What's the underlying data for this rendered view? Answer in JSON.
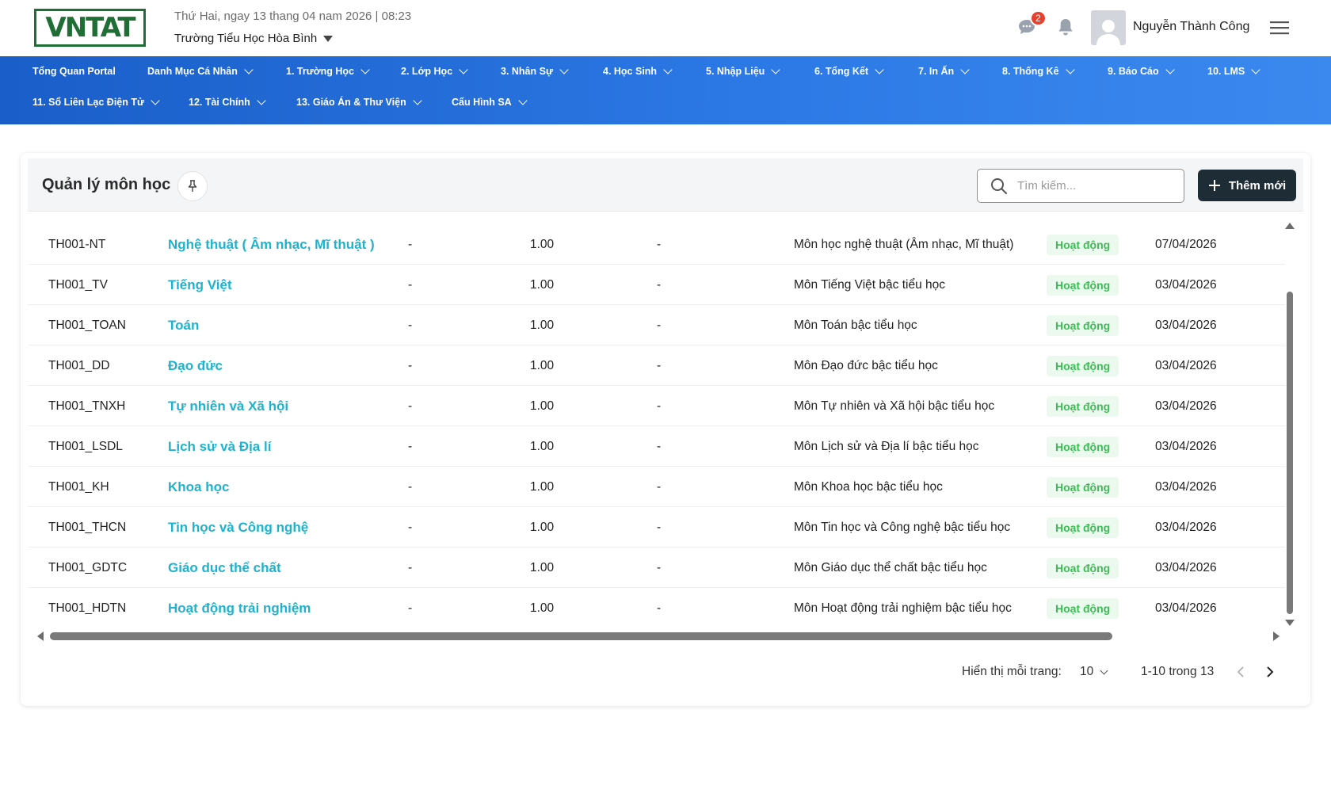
{
  "header": {
    "logo_text": "VNTAT",
    "date_line": "Thứ Hai, ngay 13 thang 04 nam 2026 | 08:23",
    "school_name": "Trường Tiểu Học Hòa Bình",
    "chat_badge_count": "2",
    "user_name": "Nguyễn Thành Công"
  },
  "nav": {
    "row1": [
      {
        "label": "Tổng Quan Portal",
        "has_dropdown": false
      },
      {
        "label": "Danh Mục Cá Nhân",
        "has_dropdown": true
      },
      {
        "label": "1. Trường Học",
        "has_dropdown": true
      },
      {
        "label": "2. Lớp Học",
        "has_dropdown": true
      },
      {
        "label": "3. Nhân Sự",
        "has_dropdown": true
      },
      {
        "label": "4. Học Sinh",
        "has_dropdown": true
      },
      {
        "label": "5. Nhập Liệu",
        "has_dropdown": true
      },
      {
        "label": "6. Tổng Kết",
        "has_dropdown": true
      },
      {
        "label": "7. In Ấn",
        "has_dropdown": true
      },
      {
        "label": "8. Thống Kê",
        "has_dropdown": true
      },
      {
        "label": "9. Báo Cáo",
        "has_dropdown": true
      },
      {
        "label": "10. LMS",
        "has_dropdown": true
      }
    ],
    "row2": [
      {
        "label": "11. Sổ Liên Lạc Điện Tử",
        "has_dropdown": true
      },
      {
        "label": "12. Tài Chính",
        "has_dropdown": true
      },
      {
        "label": "13. Giáo Án & Thư Viện",
        "has_dropdown": true
      },
      {
        "label": "Cấu Hình SA",
        "has_dropdown": true
      }
    ]
  },
  "page": {
    "title": "Quản lý môn học",
    "search_placeholder": "Tìm kiếm...",
    "add_button_label": "Thêm mới"
  },
  "table": {
    "rows": [
      {
        "code": "TH001-NT",
        "name": "Nghệ thuật ( Âm nhạc, Mĩ thuật )",
        "col3": "-",
        "coef": "1.00",
        "col5": "-",
        "description": "Môn học nghệ thuật (Âm nhạc, Mĩ thuật)",
        "status": "Hoạt động",
        "date": "07/04/2026"
      },
      {
        "code": "TH001_TV",
        "name": "Tiếng Việt",
        "col3": "-",
        "coef": "1.00",
        "col5": "-",
        "description": "Môn Tiếng Việt bậc tiểu học",
        "status": "Hoạt động",
        "date": "03/04/2026"
      },
      {
        "code": "TH001_TOAN",
        "name": "Toán",
        "col3": "-",
        "coef": "1.00",
        "col5": "-",
        "description": "Môn Toán bậc tiểu học",
        "status": "Hoạt động",
        "date": "03/04/2026"
      },
      {
        "code": "TH001_DD",
        "name": "Đạo đức",
        "col3": "-",
        "coef": "1.00",
        "col5": "-",
        "description": "Môn Đạo đức bậc tiểu học",
        "status": "Hoạt động",
        "date": "03/04/2026"
      },
      {
        "code": "TH001_TNXH",
        "name": "Tự nhiên và Xã hội",
        "col3": "-",
        "coef": "1.00",
        "col5": "-",
        "description": "Môn Tự nhiên và Xã hội bậc tiểu học",
        "status": "Hoạt động",
        "date": "03/04/2026"
      },
      {
        "code": "TH001_LSDL",
        "name": "Lịch sử và Địa lí",
        "col3": "-",
        "coef": "1.00",
        "col5": "-",
        "description": "Môn Lịch sử và Địa lí bậc tiểu học",
        "status": "Hoạt động",
        "date": "03/04/2026"
      },
      {
        "code": "TH001_KH",
        "name": "Khoa học",
        "col3": "-",
        "coef": "1.00",
        "col5": "-",
        "description": "Môn Khoa học bậc tiểu học",
        "status": "Hoạt động",
        "date": "03/04/2026"
      },
      {
        "code": "TH001_THCN",
        "name": "Tin học và Công nghệ",
        "col3": "-",
        "coef": "1.00",
        "col5": "-",
        "description": "Môn Tin học và Công nghệ bậc tiểu học",
        "status": "Hoạt động",
        "date": "03/04/2026"
      },
      {
        "code": "TH001_GDTC",
        "name": "Giáo dục thể chất",
        "col3": "-",
        "coef": "1.00",
        "col5": "-",
        "description": "Môn Giáo dục thể chất bậc tiểu học",
        "status": "Hoạt động",
        "date": "03/04/2026"
      },
      {
        "code": "TH001_HDTN",
        "name": "Hoạt động trải nghiệm",
        "col3": "-",
        "coef": "1.00",
        "col5": "-",
        "description": "Môn Hoạt động trải nghiệm bậc tiểu học",
        "status": "Hoạt động",
        "date": "03/04/2026"
      }
    ]
  },
  "pagination": {
    "per_page_label": "Hiển thị mỗi trang:",
    "per_page_value": "10",
    "range_text": "1-10 trong 13"
  },
  "colors": {
    "nav_gradient_start": "#1a5ec9",
    "nav_gradient_end": "#3b89ef",
    "subject_link": "#1db3cf",
    "status_green": "#3dbc55",
    "add_button_bg": "#1e2c35",
    "logo_green": "#1f6e35"
  },
  "icons": {
    "chat": "chat-bubble-icon",
    "bell": "bell-icon",
    "menu": "hamburger-menu-icon",
    "pin": "pin-icon",
    "search": "search-icon",
    "plus": "plus-icon"
  }
}
